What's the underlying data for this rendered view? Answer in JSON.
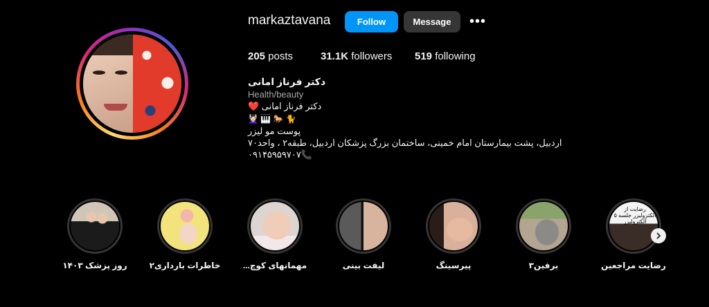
{
  "profile": {
    "username": "markaztavana",
    "follow_label": "Follow",
    "message_label": "Message",
    "more_label": "•••",
    "posts_count": "205",
    "posts_label": "posts",
    "followers_count": "31.1K",
    "followers_label": "followers",
    "following_count": "519",
    "following_label": "following"
  },
  "bio": {
    "name": "دکتر فرناز امانی",
    "category": "Health/beauty",
    "line1": "دکتر فرناز امانی ❤️",
    "line2": "💆🏻‍♀️ 🎹 🐎 🐈",
    "line3": "پوست مو لیزر",
    "line4": "اردبیل، پشت بیمارستان امام خمینی، ساختمان بزرگ پزشکان اردبیل، طبقه۲ ، واحد۷۰",
    "line5": "۰۹۱۴۵۹۵۹۷۰۷📞"
  },
  "highlights": [
    {
      "label": "روز پزشک ۱۴۰۳"
    },
    {
      "label": "خاطرات بارداری۲"
    },
    {
      "label": "مهمانهای کوچ..."
    },
    {
      "label": "لیفت بینی"
    },
    {
      "label": "پیرسینگ"
    },
    {
      "label": "برفین۳"
    },
    {
      "label": "رضایت مراجعین"
    }
  ],
  "highlight_overlay_text": "رضایت از الکترولیزر جلسه ۵ الکترولیزر",
  "colors": {
    "background": "#000000",
    "follow": "#0095f6",
    "message": "#363636"
  },
  "icons": {
    "more": "more-horizontal-icon",
    "next": "chevron-right-icon"
  }
}
